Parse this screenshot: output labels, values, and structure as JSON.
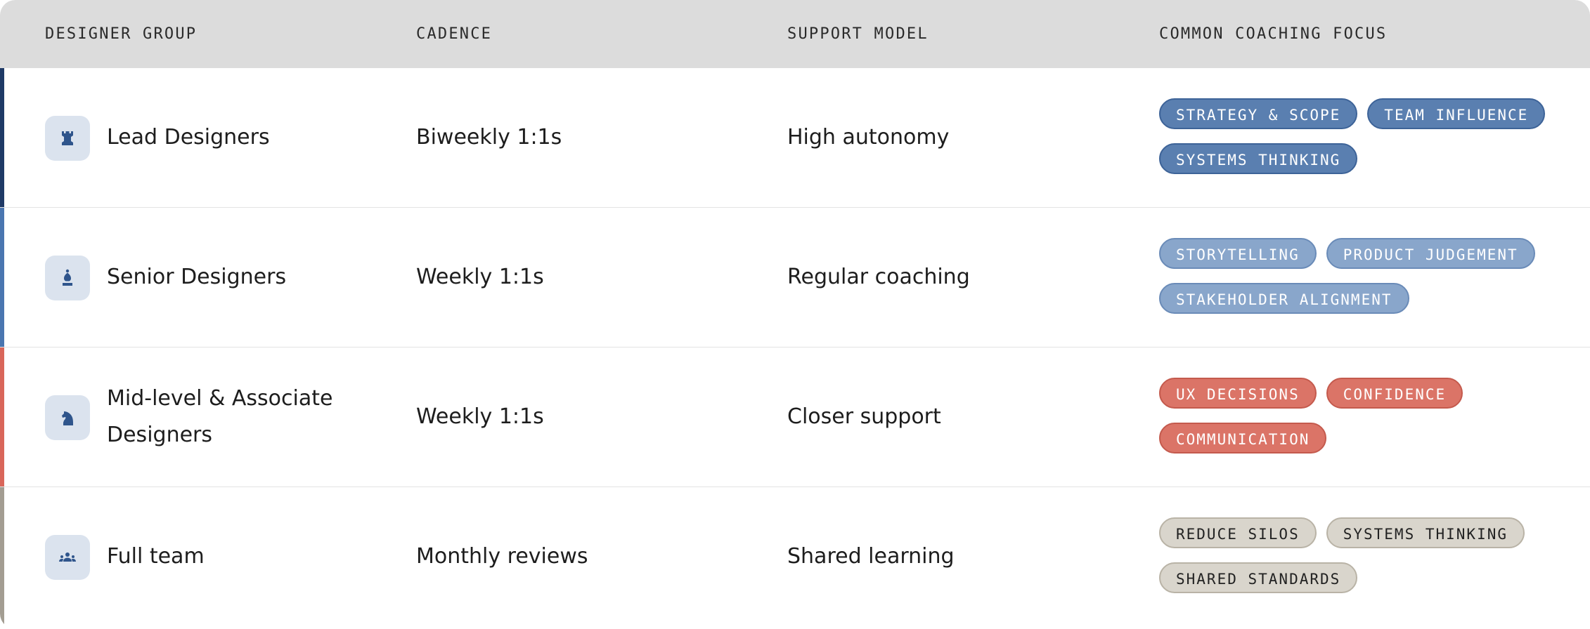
{
  "headers": {
    "group": "DESIGNER GROUP",
    "cadence": "CADENCE",
    "support": "SUPPORT MODEL",
    "focus": "COMMON COACHING FOCUS"
  },
  "rows": [
    {
      "group": "Lead Designers",
      "cadence": "Biweekly 1:1s",
      "support": "High autonomy",
      "icon": "rook-icon",
      "accent": "#1f3a66",
      "tags": [
        "STRATEGY & SCOPE",
        "TEAM INFLUENCE",
        "SYSTEMS THINKING"
      ]
    },
    {
      "group": "Senior Designers",
      "cadence": "Weekly 1:1s",
      "support": "Regular coaching",
      "icon": "bishop-icon",
      "accent": "#4a76b0",
      "tags": [
        "STORYTELLING",
        "PRODUCT JUDGEMENT",
        "STAKEHOLDER ALIGNMENT"
      ]
    },
    {
      "group": "Mid-level & Associate Designers",
      "cadence": "Weekly 1:1s",
      "support": "Closer support",
      "icon": "knight-icon",
      "accent": "#d9665a",
      "tags": [
        "UX DECISIONS",
        "CONFIDENCE",
        "COMMUNICATION"
      ]
    },
    {
      "group": "Full team",
      "cadence": "Monthly reviews",
      "support": "Shared learning",
      "icon": "team-icon",
      "accent": "#a39d92",
      "tags": [
        "REDUCE SILOS",
        "SYSTEMS THINKING",
        "SHARED STANDARDS"
      ]
    }
  ]
}
